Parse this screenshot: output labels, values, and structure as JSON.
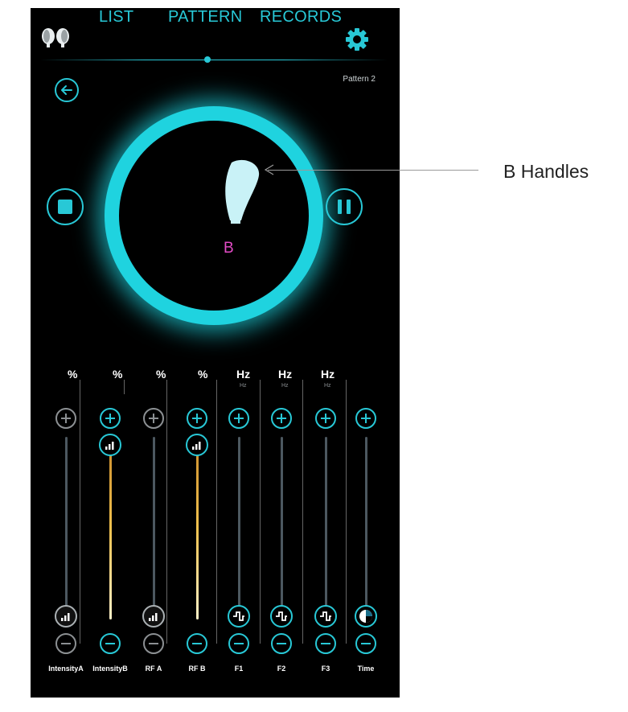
{
  "nav": {
    "list": "LIST",
    "pattern": "PATTERN",
    "records": "RECORDS"
  },
  "header": {
    "pattern_name": "Pattern 2"
  },
  "icons": {
    "back": "back-arrow-icon",
    "stop": "stop-icon",
    "pause": "pause-icon",
    "settings": "gear-icon",
    "handles": "handles-icon",
    "handpiece": "handpiece-icon"
  },
  "zone": {
    "letter": "B"
  },
  "annotation": {
    "text": "B Handles"
  },
  "colors": {
    "accent": "#28c8d6",
    "zone_letter": "#e34bc6",
    "active_track": "#f2c24e"
  },
  "units": [
    "%",
    "%",
    "%",
    "%",
    "Hz",
    "Hz",
    "Hz"
  ],
  "unit_subs": [
    "",
    "",
    "",
    "",
    "Hz",
    "Hz",
    "Hz"
  ],
  "sliders": [
    {
      "label": "IntensityA",
      "level": 0,
      "active": false,
      "knob": "signal-icon"
    },
    {
      "label": "IntensityB",
      "level": 1,
      "active": true,
      "knob": "signal-icon"
    },
    {
      "label": "RF A",
      "level": 0,
      "active": false,
      "knob": "signal-icon"
    },
    {
      "label": "RF B",
      "level": 1,
      "active": true,
      "knob": "signal-icon"
    },
    {
      "label": "F1",
      "level": 0,
      "active": true,
      "knob": "wave-icon"
    },
    {
      "label": "F2",
      "level": 0,
      "active": true,
      "knob": "wave-icon"
    },
    {
      "label": "F3",
      "level": 0,
      "active": true,
      "knob": "wave-icon"
    },
    {
      "label": "Time",
      "level": 0,
      "active": true,
      "knob": "timer-icon"
    }
  ]
}
